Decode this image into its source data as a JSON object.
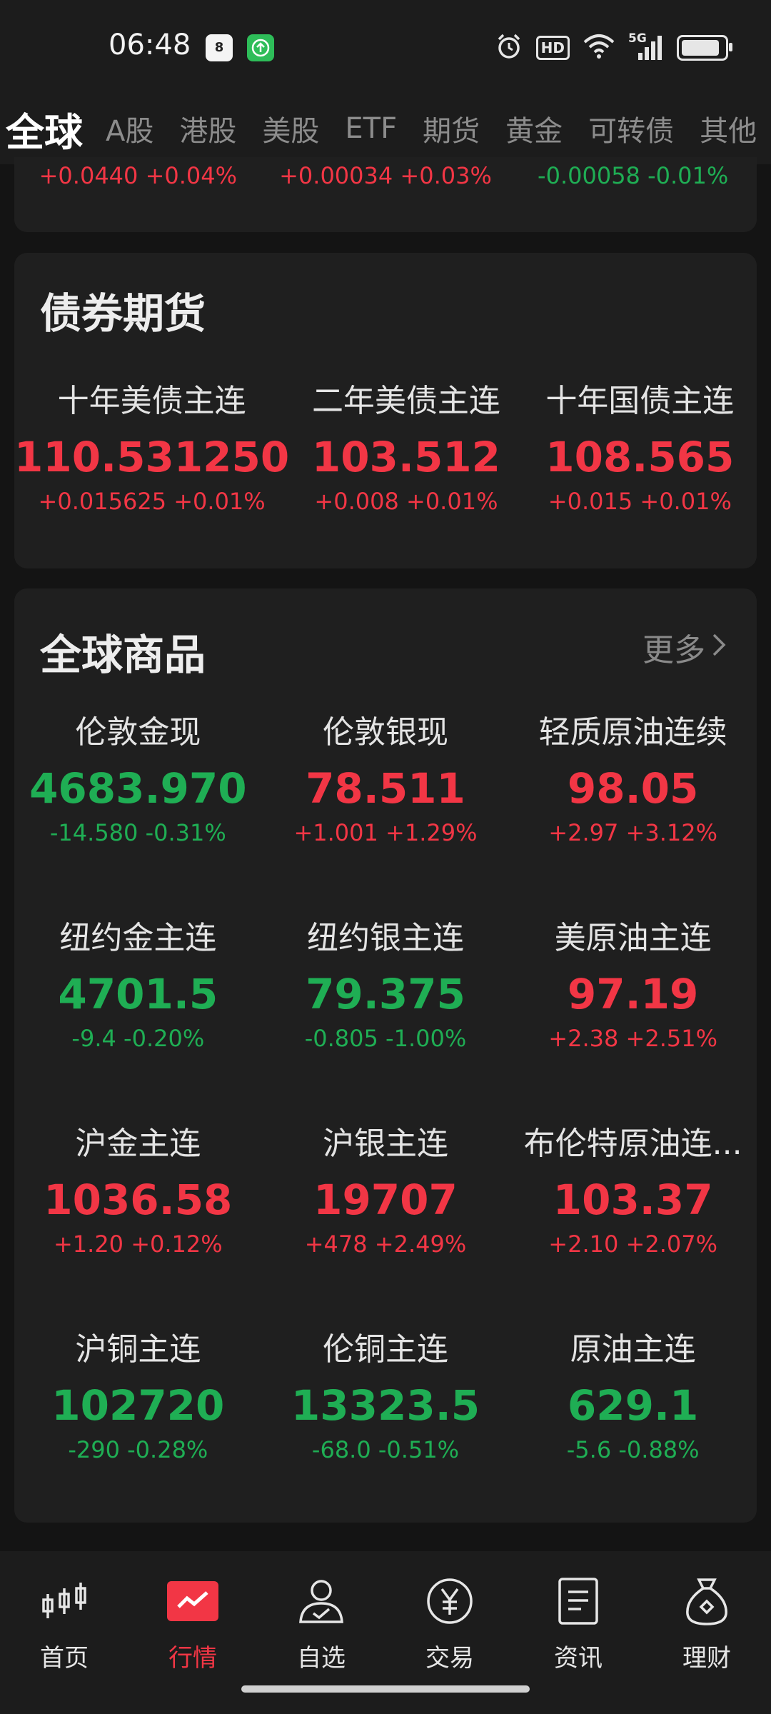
{
  "status": {
    "time": "06:48",
    "calendar_day": "8",
    "hd": "HD",
    "network": "5G",
    "battery_level": 0.9
  },
  "tabs": [
    {
      "label": "全球",
      "active": true
    },
    {
      "label": "A股"
    },
    {
      "label": "港股"
    },
    {
      "label": "美股"
    },
    {
      "label": "ETF"
    },
    {
      "label": "期货"
    },
    {
      "label": "黄金"
    },
    {
      "label": "可转债"
    },
    {
      "label": "其他"
    }
  ],
  "top_card": {
    "items": [
      {
        "change": "+0.0440 +0.04%",
        "trend": "up"
      },
      {
        "change": "+0.00034 +0.03%",
        "trend": "up"
      },
      {
        "change": "-0.00058 -0.01%",
        "trend": "down"
      }
    ]
  },
  "bond_futures": {
    "title": "债券期货",
    "items": [
      {
        "name": "十年美债主连",
        "price": "110.531250",
        "change": "+0.015625 +0.01%",
        "trend": "up"
      },
      {
        "name": "二年美债主连",
        "price": "103.512",
        "change": "+0.008 +0.01%",
        "trend": "up"
      },
      {
        "name": "十年国债主连",
        "price": "108.565",
        "change": "+0.015 +0.01%",
        "trend": "up"
      }
    ]
  },
  "global_commodities": {
    "title": "全球商品",
    "more_label": "更多",
    "items": [
      {
        "name": "伦敦金现",
        "price": "4683.970",
        "change": "-14.580 -0.31%",
        "trend": "down"
      },
      {
        "name": "伦敦银现",
        "price": "78.511",
        "change": "+1.001 +1.29%",
        "trend": "up"
      },
      {
        "name": "轻质原油连续",
        "price": "98.05",
        "change": "+2.97 +3.12%",
        "trend": "up"
      },
      {
        "name": "纽约金主连",
        "price": "4701.5",
        "change": "-9.4 -0.20%",
        "trend": "down"
      },
      {
        "name": "纽约银主连",
        "price": "79.375",
        "change": "-0.805 -1.00%",
        "trend": "down"
      },
      {
        "name": "美原油主连",
        "price": "97.19",
        "change": "+2.38 +2.51%",
        "trend": "up"
      },
      {
        "name": "沪金主连",
        "price": "1036.58",
        "change": "+1.20 +0.12%",
        "trend": "up"
      },
      {
        "name": "沪银主连",
        "price": "19707",
        "change": "+478 +2.49%",
        "trend": "up"
      },
      {
        "name": "布伦特原油连...",
        "price": "103.37",
        "change": "+2.10 +2.07%",
        "trend": "up"
      },
      {
        "name": "沪铜主连",
        "price": "102720",
        "change": "-290 -0.28%",
        "trend": "down"
      },
      {
        "name": "伦铜主连",
        "price": "13323.5",
        "change": "-68.0 -0.51%",
        "trend": "down"
      },
      {
        "name": "原油主连",
        "price": "629.1",
        "change": "-5.6 -0.88%",
        "trend": "down"
      }
    ]
  },
  "colors": {
    "up": "#f23645",
    "down": "#1fae54",
    "active_tab_icon_bg": "#f23645"
  },
  "bottom_nav": [
    {
      "label": "首页",
      "icon": "candlestick-icon"
    },
    {
      "label": "行情",
      "icon": "market-chart-icon",
      "active": true
    },
    {
      "label": "自选",
      "icon": "user-check-icon"
    },
    {
      "label": "交易",
      "icon": "yuan-circle-icon"
    },
    {
      "label": "资讯",
      "icon": "document-icon"
    },
    {
      "label": "理财",
      "icon": "money-bag-icon"
    }
  ]
}
